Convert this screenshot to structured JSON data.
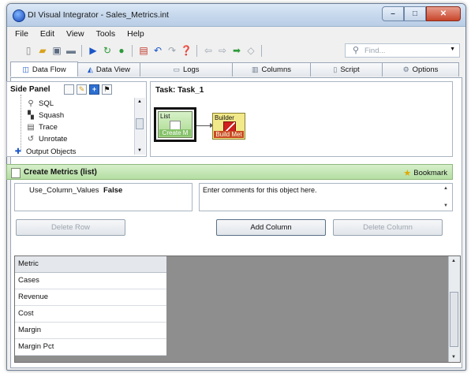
{
  "window": {
    "title": "DI Visual Integrator - Sales_Metrics.int",
    "controls": [
      "–",
      "□",
      "✕"
    ]
  },
  "menu": [
    "File",
    "Edit",
    "View",
    "Tools",
    "Help"
  ],
  "toolbar": {
    "find_placeholder": "Find...",
    "icons": [
      "new-doc-icon",
      "open-folder-icon",
      "save-icon",
      "print-icon",
      "run-icon",
      "refresh-icon",
      "stop-icon",
      "table-icon",
      "undo-icon",
      "redo-icon",
      "help-icon",
      "back-icon",
      "forward-icon",
      "go-icon",
      "erase-icon",
      "search-icon"
    ]
  },
  "tabs": [
    {
      "label": "Data Flow",
      "icon": "data-flow-icon",
      "active": true
    },
    {
      "label": "Data View",
      "icon": "data-view-icon",
      "active": false
    },
    {
      "label": "Logs",
      "icon": "logs-icon",
      "active": false
    },
    {
      "label": "Columns",
      "icon": "columns-icon",
      "active": false
    },
    {
      "label": "Script",
      "icon": "script-icon",
      "active": false
    },
    {
      "label": "Options",
      "icon": "options-icon",
      "active": false
    }
  ],
  "side_panel": {
    "title": "Side Panel",
    "items": [
      "SQL",
      "Squash",
      "Trace",
      "Unrotate",
      "Output Objects"
    ]
  },
  "task": {
    "title": "Task: Task_1",
    "nodes": [
      {
        "top": "List",
        "bottom": "Create M"
      },
      {
        "top": "Builder",
        "bottom": "Build Met"
      }
    ]
  },
  "properties": {
    "title": "Create Metrics (list)",
    "bookmark": "Bookmark",
    "property_name": "Use_Column_Values",
    "property_value": "False",
    "comments": "Enter comments for this object here."
  },
  "buttons": {
    "delete_row": "Delete Row",
    "add_column": "Add Column",
    "delete_column": "Delete Column"
  },
  "table": {
    "header": "Metric",
    "rows": [
      "Cases",
      "Revenue",
      "Cost",
      "Margin",
      "Margin Pct"
    ]
  }
}
